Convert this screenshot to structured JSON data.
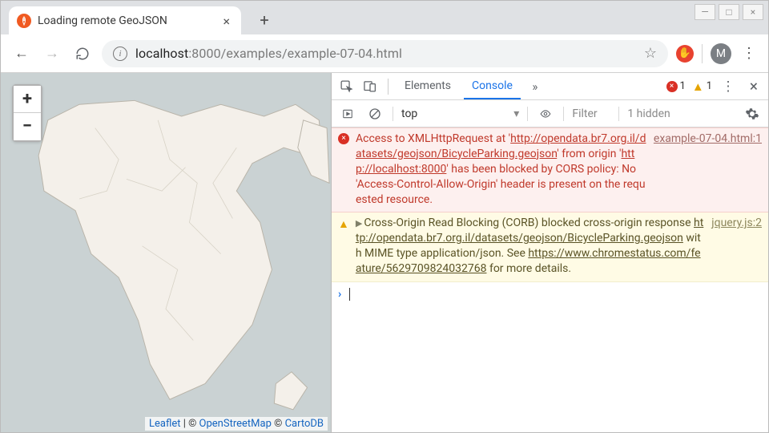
{
  "window": {
    "tab_title": "Loading remote GeoJSON",
    "minimize": "—",
    "maximize": "□",
    "close": "×",
    "new_tab": "+"
  },
  "toolbar": {
    "back": "←",
    "forward": "→",
    "reload": "↻",
    "url_host": "localhost",
    "url_port": ":8000",
    "url_path": "/examples/example-07-04.html",
    "star": "☆",
    "extension_glyph": "✋",
    "avatar_letter": "M",
    "menu": "⋮"
  },
  "map": {
    "zoom_in": "+",
    "zoom_out": "−",
    "attribution_leaflet": "Leaflet",
    "attribution_sep1": " | © ",
    "attribution_osm": "OpenStreetMap",
    "attribution_sep2": " © ",
    "attribution_carto": "CartoDB"
  },
  "devtools": {
    "tabs": {
      "elements": "Elements",
      "console": "Console",
      "more": "»"
    },
    "counts": {
      "errors": "1",
      "error_glyph": "×",
      "warnings": "1",
      "warning_glyph": "▲"
    },
    "menu": "⋮",
    "close": "×",
    "filter_bar": {
      "context": "top",
      "context_caret": "▾",
      "filter_placeholder": "Filter",
      "hidden": "1 hidden"
    },
    "messages": {
      "error": {
        "pre": "Access to XMLHttpRequest at '",
        "link1": "http://opendata.br7.org.il/datasets/geojson/BicycleParking.geojson",
        "mid": "' from origin '",
        "link2": "http://localhost:8000",
        "post": "' has been blocked by CORS policy: No 'Access-Control-Allow-Origin' header is present on the requested resource.",
        "source": "example-07-04.html:1"
      },
      "warning": {
        "pre": "Cross-Origin Read Blocking (CORB) blocked cross-origin response ",
        "link1": "http://opendata.br7.org.il/datasets/geojson/BicycleParking.geojson",
        "mid": " with MIME type application/json. See ",
        "link2": "https://www.chromestatus.com/feature/5629709824032768",
        "post": " for more details.",
        "source": "jquery.js:2"
      }
    },
    "prompt": "›"
  }
}
